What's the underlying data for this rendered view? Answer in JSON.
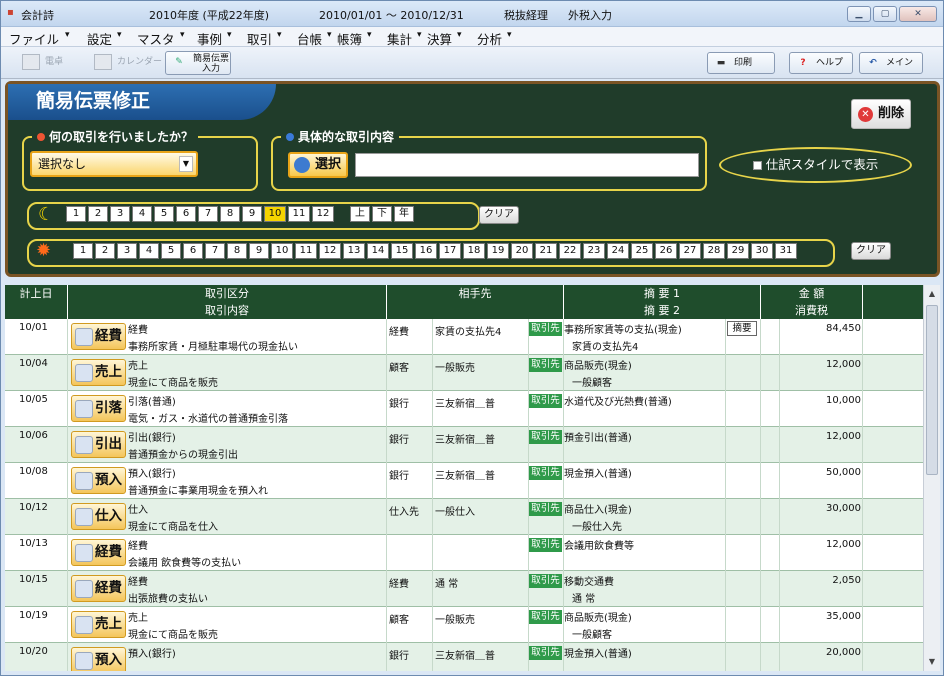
{
  "titlebar": {
    "app": "会計詩",
    "period": "2010年度 (平成22年度)",
    "dates": "2010/01/01 ～ 2010/12/31",
    "tax": "税抜経理",
    "taxin": "外税入力"
  },
  "menu": [
    "ファイル",
    "設定",
    "マスタ",
    "事例",
    "取引",
    "台帳",
    "帳簿",
    "集計",
    "決算",
    "分析"
  ],
  "toolbar": {
    "denbo": "電卓",
    "calendar": "カレンダー",
    "kanni": "簡易伝票入力",
    "print": "印刷",
    "help": "ヘルプ",
    "main": "メイン"
  },
  "page": {
    "title": "簡易伝票修正",
    "delete": "削除"
  },
  "filter": {
    "q1_label": "何の取引を行いましたか？",
    "select_value": "選択なし",
    "q2_label": "具体的な取引内容",
    "select_btn": "選択",
    "shiwake": "仕訳スタイルで表示",
    "clear": "クリア"
  },
  "months": [
    "1",
    "2",
    "3",
    "4",
    "5",
    "6",
    "7",
    "8",
    "9",
    "10",
    "11",
    "12"
  ],
  "month_extra": [
    "上",
    "下",
    "年"
  ],
  "days": [
    "1",
    "2",
    "3",
    "4",
    "5",
    "6",
    "7",
    "8",
    "9",
    "10",
    "11",
    "12",
    "13",
    "14",
    "15",
    "16",
    "17",
    "18",
    "19",
    "20",
    "21",
    "22",
    "23",
    "24",
    "25",
    "26",
    "27",
    "28",
    "29",
    "30",
    "31"
  ],
  "headers": {
    "date": "計上日",
    "kubun": "取引区分",
    "naiyo": "取引内容",
    "aite": "相手先",
    "tekiyo1": "摘 要 1",
    "tekiyo2": "摘 要 2",
    "kingaku": "金 額",
    "tax": "消費税"
  },
  "tag_label": "取引先",
  "tekiyo_btn": "摘要",
  "rows": [
    {
      "date": "10/01",
      "cat": "経費",
      "title": "経費",
      "desc": "事務所家賃・月極駐車場代の現金払い",
      "aite_type": "経費",
      "aite": "家賃の支払先4",
      "t1": "事務所家賃等の支払(現金)",
      "t2": "家賃の支払先4",
      "amount": "84,450"
    },
    {
      "date": "10/04",
      "cat": "売上",
      "title": "売上",
      "desc": "現金にて商品を販売",
      "aite_type": "顧客",
      "aite": "一般販売",
      "t1": "商品販売(現金)",
      "t2": "一般顧客",
      "amount": "12,000"
    },
    {
      "date": "10/05",
      "cat": "引落",
      "title": "引落(普通)",
      "desc": "電気・ガス・水道代の普通預金引落",
      "aite_type": "銀行",
      "aite": "三友新宿＿普",
      "t1": "水道代及び光熱費(普通)",
      "t2": "",
      "amount": "10,000"
    },
    {
      "date": "10/06",
      "cat": "引出",
      "title": "引出(銀行)",
      "desc": "普通預金からの現金引出",
      "aite_type": "銀行",
      "aite": "三友新宿＿普",
      "t1": "預金引出(普通)",
      "t2": "",
      "amount": "12,000"
    },
    {
      "date": "10/08",
      "cat": "預入",
      "title": "預入(銀行)",
      "desc": "普通預金に事業用現金を預入れ",
      "aite_type": "銀行",
      "aite": "三友新宿＿普",
      "t1": "現金預入(普通)",
      "t2": "",
      "amount": "50,000"
    },
    {
      "date": "10/12",
      "cat": "仕入",
      "title": "仕入",
      "desc": "現金にて商品を仕入",
      "aite_type": "仕入先",
      "aite": "一般仕入",
      "t1": "商品仕入(現金)",
      "t2": "一般仕入先",
      "amount": "30,000"
    },
    {
      "date": "10/13",
      "cat": "経費",
      "title": "経費",
      "desc": "会議用 飲食費等の支払い",
      "aite_type": "",
      "aite": "",
      "t1": "会議用飲食費等",
      "t2": "",
      "amount": "12,000"
    },
    {
      "date": "10/15",
      "cat": "経費",
      "title": "経費",
      "desc": "出張旅費の支払い",
      "aite_type": "経費",
      "aite": "通 常",
      "t1": "移動交通費",
      "t2": "通 常",
      "amount": "2,050"
    },
    {
      "date": "10/19",
      "cat": "売上",
      "title": "売上",
      "desc": "現金にて商品を販売",
      "aite_type": "顧客",
      "aite": "一般販売",
      "t1": "商品販売(現金)",
      "t2": "一般顧客",
      "amount": "35,000"
    },
    {
      "date": "10/20",
      "cat": "預入",
      "title": "預入(銀行)",
      "desc": "",
      "aite_type": "銀行",
      "aite": "三友新宿＿普",
      "t1": "現金預入(普通)",
      "t2": "",
      "amount": "20,000"
    }
  ]
}
